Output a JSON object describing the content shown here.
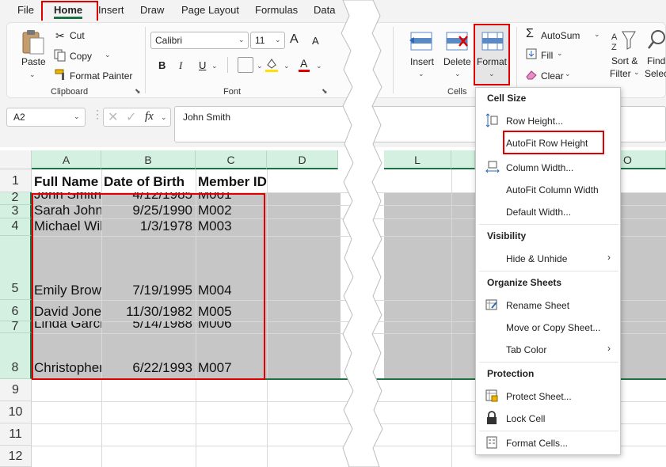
{
  "menu": {
    "tabs": [
      "File",
      "Home",
      "Insert",
      "Draw",
      "Page Layout",
      "Formulas",
      "Data"
    ]
  },
  "ribbon": {
    "clipboard": {
      "paste": "Paste",
      "cut": "Cut",
      "copy": "Copy",
      "format_painter": "Format Painter",
      "label": "Clipboard"
    },
    "font": {
      "name": "Calibri",
      "size": "11",
      "bold": "B",
      "italic": "I",
      "underline": "U",
      "font_color_letter": "A",
      "grow": "A",
      "shrink": "A",
      "label": "Font"
    },
    "cells": {
      "insert": "Insert",
      "delete": "Delete",
      "format": "Format",
      "label": "Cells"
    },
    "editing": {
      "autosum": "AutoSum",
      "fill": "Fill",
      "clear": "Clear",
      "sort_filter_1": "Sort &",
      "sort_filter_2": "Filter",
      "find_1": "Find",
      "find_2": "Selec"
    }
  },
  "formula_bar": {
    "name_box": "A2",
    "fx": "fx",
    "formula": "John Smith"
  },
  "sheet": {
    "columns": [
      "A",
      "B",
      "C",
      "D",
      "L",
      "O"
    ],
    "rows": [
      "1",
      "2",
      "3",
      "4",
      "5",
      "6",
      "7",
      "8",
      "9",
      "10",
      "11",
      "12"
    ],
    "header": [
      "Full Name",
      "Date of Birth",
      "Member ID"
    ],
    "data": [
      [
        "John Smith",
        "4/12/1985",
        "M001"
      ],
      [
        "Sarah Johnson",
        "9/25/1990",
        "M002"
      ],
      [
        "Michael Williams",
        "1/3/1978",
        "M003"
      ],
      [
        "Emily Brown",
        "7/19/1995",
        "M004"
      ],
      [
        "David Jones",
        "11/30/1982",
        "M005"
      ],
      [
        "Linda Garcia",
        "5/14/1988",
        "M006"
      ],
      [
        "Christopher",
        "6/22/1993",
        "M007"
      ]
    ]
  },
  "dropdown": {
    "cell_size": "Cell Size",
    "row_height": "Row Height...",
    "autofit_row": "AutoFit Row Height",
    "col_width": "Column Width...",
    "autofit_col": "AutoFit Column Width",
    "default_width": "Default Width...",
    "visibility": "Visibility",
    "hide_unhide": "Hide & Unhide",
    "organize": "Organize Sheets",
    "rename": "Rename Sheet",
    "move_copy": "Move or Copy Sheet...",
    "tab_color": "Tab Color",
    "protection": "Protection",
    "protect_sheet": "Protect Sheet...",
    "lock_cell": "Lock Cell",
    "format_cells": "Format Cells..."
  },
  "colors": {
    "accent": "#1e7145",
    "highlight": "#e00000",
    "selection": "#c6c6c6"
  }
}
